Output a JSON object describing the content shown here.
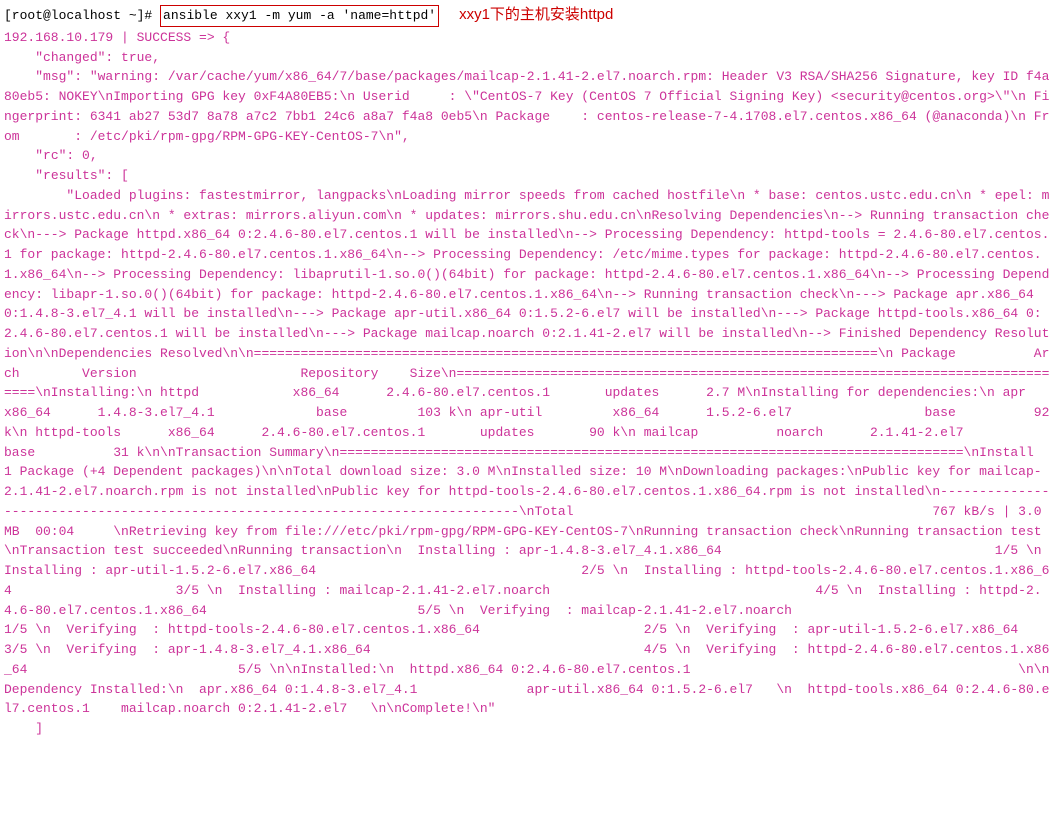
{
  "prompt": "[root@localhost ~]#",
  "command": "ansible xxy1 -m yum -a 'name=httpd'",
  "annotation": "xxy1下的主机安装httpd",
  "output": "192.168.10.179 | SUCCESS => {\n    \"changed\": true, \n    \"msg\": \"warning: /var/cache/yum/x86_64/7/base/packages/mailcap-2.1.41-2.el7.noarch.rpm: Header V3 RSA/SHA256 Signature, key ID f4a80eb5: NOKEY\\nImporting GPG key 0xF4A80EB5:\\n Userid     : \\\"CentOS-7 Key (CentOS 7 Official Signing Key) <security@centos.org>\\\"\\n Fingerprint: 6341 ab27 53d7 8a78 a7c2 7bb1 24c6 a8a7 f4a8 0eb5\\n Package    : centos-release-7-4.1708.el7.centos.x86_64 (@anaconda)\\n From       : /etc/pki/rpm-gpg/RPM-GPG-KEY-CentOS-7\\n\", \n    \"rc\": 0, \n    \"results\": [\n        \"Loaded plugins: fastestmirror, langpacks\\nLoading mirror speeds from cached hostfile\\n * base: centos.ustc.edu.cn\\n * epel: mirrors.ustc.edu.cn\\n * extras: mirrors.aliyun.com\\n * updates: mirrors.shu.edu.cn\\nResolving Dependencies\\n--> Running transaction check\\n---> Package httpd.x86_64 0:2.4.6-80.el7.centos.1 will be installed\\n--> Processing Dependency: httpd-tools = 2.4.6-80.el7.centos.1 for package: httpd-2.4.6-80.el7.centos.1.x86_64\\n--> Processing Dependency: /etc/mime.types for package: httpd-2.4.6-80.el7.centos.1.x86_64\\n--> Processing Dependency: libaprutil-1.so.0()(64bit) for package: httpd-2.4.6-80.el7.centos.1.x86_64\\n--> Processing Dependency: libapr-1.so.0()(64bit) for package: httpd-2.4.6-80.el7.centos.1.x86_64\\n--> Running transaction check\\n---> Package apr.x86_64 0:1.4.8-3.el7_4.1 will be installed\\n---> Package apr-util.x86_64 0:1.5.2-6.el7 will be installed\\n---> Package httpd-tools.x86_64 0:2.4.6-80.el7.centos.1 will be installed\\n---> Package mailcap.noarch 0:2.1.41-2.el7 will be installed\\n--> Finished Dependency Resolution\\n\\nDependencies Resolved\\n\\n================================================================================\\n Package          Arch        Version                     Repository    Size\\n================================================================================\\nInstalling:\\n httpd            x86_64      2.4.6-80.el7.centos.1       updates      2.7 M\\nInstalling for dependencies:\\n apr              x86_64      1.4.8-3.el7_4.1             base         103 k\\n apr-util         x86_64      1.5.2-6.el7                 base          92 k\\n httpd-tools      x86_64      2.4.6-80.el7.centos.1       updates       90 k\\n mailcap          noarch      2.1.41-2.el7                base          31 k\\n\\nTransaction Summary\\n================================================================================\\nInstall  1 Package (+4 Dependent packages)\\n\\nTotal download size: 3.0 M\\nInstalled size: 10 M\\nDownloading packages:\\nPublic key for mailcap-2.1.41-2.el7.noarch.rpm is not installed\\nPublic key for httpd-tools-2.4.6-80.el7.centos.1.x86_64.rpm is not installed\\n--------------------------------------------------------------------------------\\nTotal                                              767 kB/s | 3.0 MB  00:04     \\nRetrieving key from file:///etc/pki/rpm-gpg/RPM-GPG-KEY-CentOS-7\\nRunning transaction check\\nRunning transaction test\\nTransaction test succeeded\\nRunning transaction\\n  Installing : apr-1.4.8-3.el7_4.1.x86_64                                   1/5 \\n  Installing : apr-util-1.5.2-6.el7.x86_64                                  2/5 \\n  Installing : httpd-tools-2.4.6-80.el7.centos.1.x86_64                     3/5 \\n  Installing : mailcap-2.1.41-2.el7.noarch                                  4/5 \\n  Installing : httpd-2.4.6-80.el7.centos.1.x86_64                           5/5 \\n  Verifying  : mailcap-2.1.41-2.el7.noarch                                  1/5 \\n  Verifying  : httpd-tools-2.4.6-80.el7.centos.1.x86_64                     2/5 \\n  Verifying  : apr-util-1.5.2-6.el7.x86_64                                  3/5 \\n  Verifying  : apr-1.4.8-3.el7_4.1.x86_64                                   4/5 \\n  Verifying  : httpd-2.4.6-80.el7.centos.1.x86_64                           5/5 \\n\\nInstalled:\\n  httpd.x86_64 0:2.4.6-80.el7.centos.1                                          \\n\\nDependency Installed:\\n  apr.x86_64 0:1.4.8-3.el7_4.1              apr-util.x86_64 0:1.5.2-6.el7   \\n  httpd-tools.x86_64 0:2.4.6-80.el7.centos.1    mailcap.noarch 0:2.1.41-2.el7   \\n\\nComplete!\\n\"\n    ]"
}
